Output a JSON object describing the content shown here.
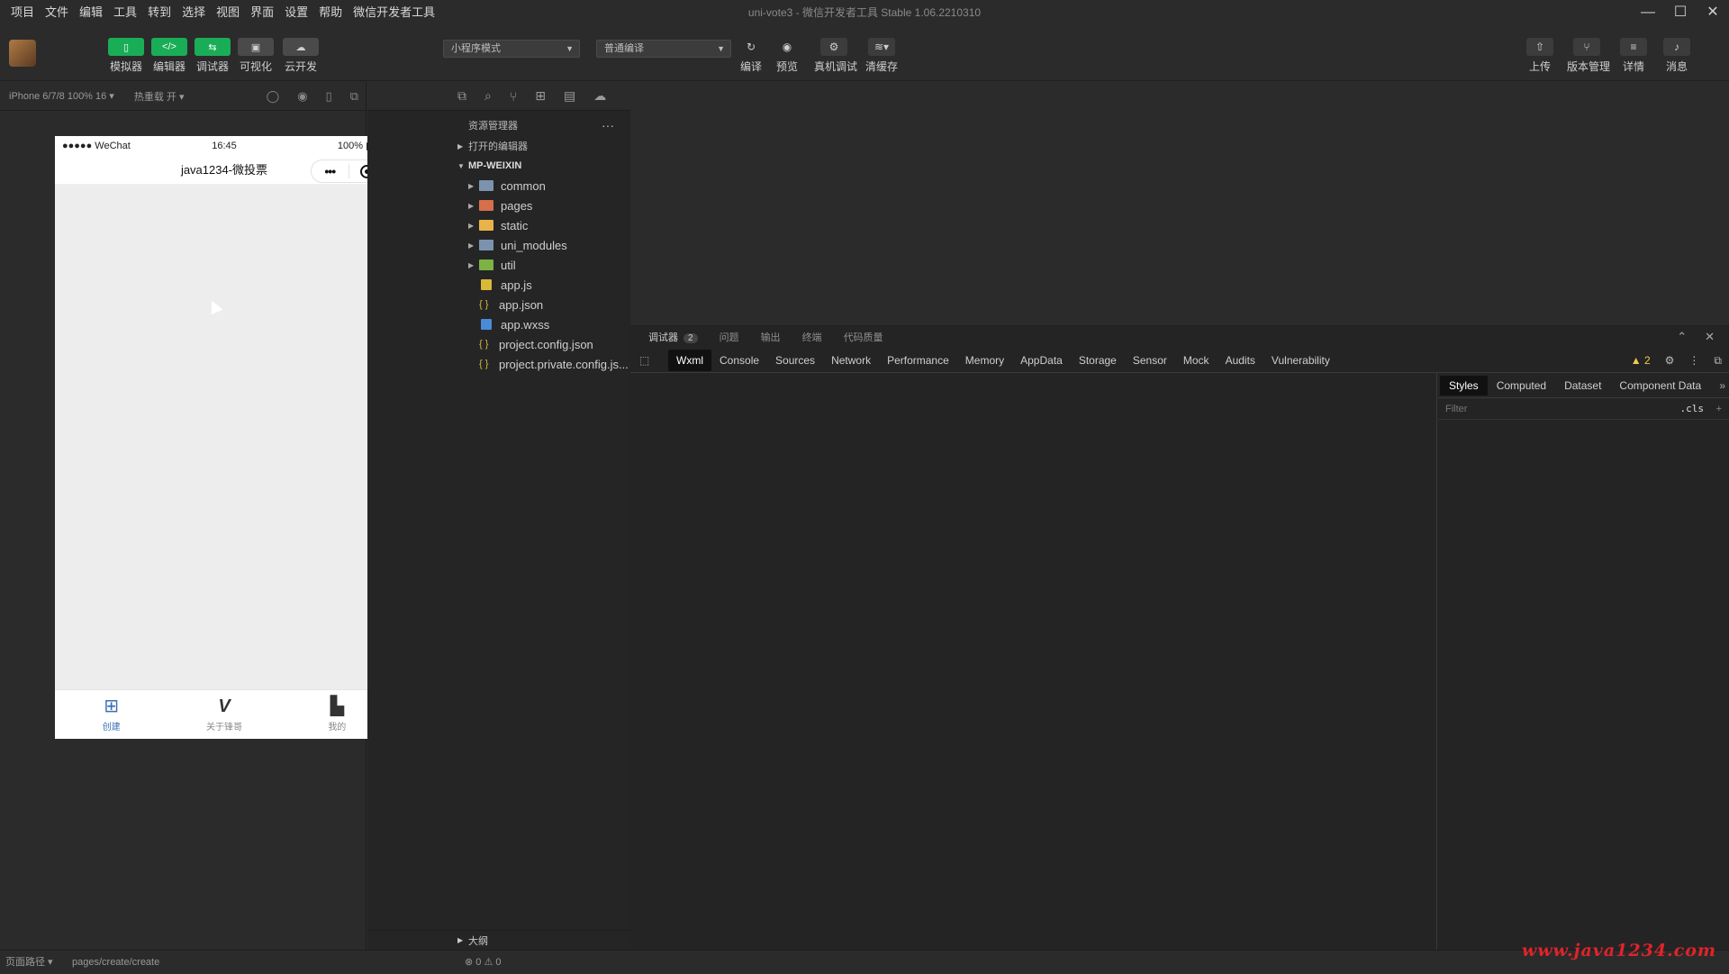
{
  "menu": [
    "项目",
    "文件",
    "编辑",
    "工具",
    "转到",
    "选择",
    "视图",
    "界面",
    "设置",
    "帮助",
    "微信开发者工具"
  ],
  "window_title": "uni-vote3 - 微信开发者工具 Stable 1.06.2210310",
  "toolbar": {
    "buttons": [
      {
        "icon": "phone-icon",
        "label": "模拟器"
      },
      {
        "icon": "code-icon",
        "label": "编辑器"
      },
      {
        "icon": "debug-icon",
        "label": "调试器"
      },
      {
        "icon": "visual-icon",
        "label": "可视化"
      },
      {
        "icon": "cloud-icon",
        "label": "云开发"
      }
    ],
    "mode_select": "小程序模式",
    "compile_select": "普通编译",
    "actions": [
      {
        "icon": "refresh-icon",
        "label": "编译"
      },
      {
        "icon": "eye-icon",
        "label": "预览"
      },
      {
        "icon": "device-icon",
        "label": "真机调试"
      },
      {
        "icon": "layers-icon",
        "label": "清缓存"
      }
    ],
    "right_actions": [
      {
        "icon": "upload-icon",
        "label": "上传"
      },
      {
        "icon": "branch-icon",
        "label": "版本管理"
      },
      {
        "icon": "menu-icon",
        "label": "详情"
      },
      {
        "icon": "bell-icon",
        "label": "消息"
      }
    ]
  },
  "simulator": {
    "device": "iPhone 6/7/8 100% 16 ▾",
    "hot_reload": "热重载 开 ▾",
    "phone": {
      "carrier": "●●●●● WeChat",
      "time": "16:45",
      "battery": "100%",
      "nav_title": "java1234-微投票",
      "tabs": [
        {
          "icon": "add-icon",
          "label": "创建",
          "active": true
        },
        {
          "icon": "vip-icon",
          "label": "关于锋哥",
          "active": false
        },
        {
          "icon": "user-icon",
          "label": "我的",
          "active": false
        }
      ]
    }
  },
  "explorer": {
    "title": "资源管理器",
    "open_editors": "打开的编辑器",
    "project": "MP-WEIXIN",
    "folders": [
      {
        "name": "common",
        "color": "folder-blue"
      },
      {
        "name": "pages",
        "color": "folder-red"
      },
      {
        "name": "static",
        "color": "folder-yellow"
      },
      {
        "name": "uni_modules",
        "color": "folder-blue"
      },
      {
        "name": "util",
        "color": "folder-green"
      }
    ],
    "files": [
      {
        "name": "app.js",
        "type": "js"
      },
      {
        "name": "app.json",
        "type": "json"
      },
      {
        "name": "app.wxss",
        "type": "wxss"
      },
      {
        "name": "project.config.json",
        "type": "json"
      },
      {
        "name": "project.private.config.js...",
        "type": "json"
      }
    ],
    "outline": "大纲"
  },
  "debugger": {
    "tabs": [
      {
        "label": "调试器",
        "badge": "2"
      },
      {
        "label": "问题"
      },
      {
        "label": "输出"
      },
      {
        "label": "终端"
      },
      {
        "label": "代码质量"
      }
    ],
    "devtools_tabs": [
      "Wxml",
      "Console",
      "Sources",
      "Network",
      "Performance",
      "Memory",
      "AppData",
      "Storage",
      "Sensor",
      "Mock",
      "Audits",
      "Vulnerability"
    ],
    "warning_count": "▲ 2",
    "styles_tabs": [
      "Styles",
      "Computed",
      "Dataset",
      "Component Data"
    ],
    "filter_placeholder": "Filter",
    "cls_label": ".cls"
  },
  "statusbar": {
    "path_label": "页面路径 ▾",
    "page_path": "pages/create/create",
    "errors": "⊗ 0 ⚠ 0"
  },
  "watermark": "www.java1234.com"
}
